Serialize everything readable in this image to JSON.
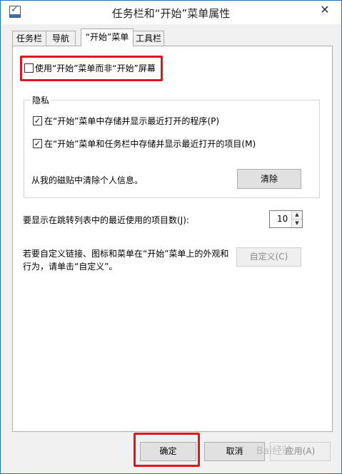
{
  "window": {
    "title": "任务栏和“开始”菜单属性",
    "close_glyph": "✕",
    "checkbox_glyph": "✓"
  },
  "tabs": [
    {
      "label": "任务栏"
    },
    {
      "label": "导航"
    },
    {
      "label": "“开始”菜单"
    },
    {
      "label": "工具栏"
    }
  ],
  "start_screen": {
    "label": "使用“开始”菜单而非“开始”屏幕",
    "checked": false
  },
  "privacy": {
    "group_title": "隐私",
    "store_programs_label": "在“开始”菜单中存储并显示最近打开的程序(P)",
    "store_items_label": "在“开始”菜单和任务栏中存储并显示最近打开的项目(M)",
    "clear_text": "从我的磁贴中清除个人信息。",
    "clear_button": "清除"
  },
  "jumplist": {
    "label": "要显示在跳转列表中的最近使用的项目数(J):",
    "value": "10",
    "up": "▲",
    "down": "▼"
  },
  "customize": {
    "text_line1": "若要自定义链接、图标和菜单在“开始”菜单上的外观和",
    "text_line2": "行为，请单击“自定义”。",
    "button": "自定义(C)"
  },
  "footer": {
    "ok": "确定",
    "cancel": "取消",
    "apply": "应用(A)"
  },
  "watermark": "Bai经验",
  "colors": {
    "highlight": "#e0161b",
    "window_border": "#2a6fb0"
  }
}
